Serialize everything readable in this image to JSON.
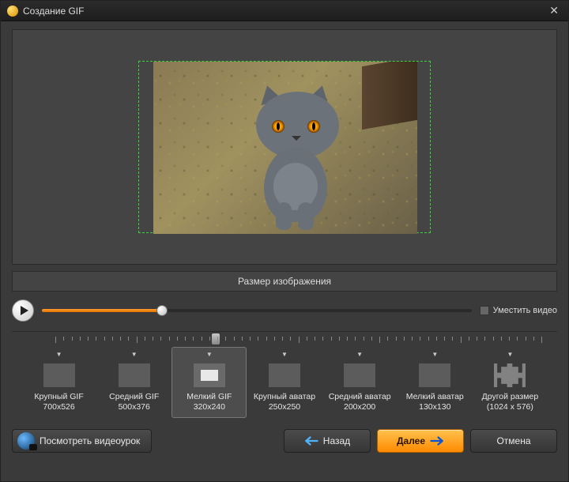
{
  "window": {
    "title": "Создание GIF"
  },
  "section": {
    "size_label": "Размер изображения"
  },
  "slider": {
    "position_percent": 28,
    "fit_label": "Уместить видео"
  },
  "presets": [
    {
      "label": "Крупный GIF",
      "dims": "700x526",
      "inner_w": 0,
      "inner_h": 0
    },
    {
      "label": "Средний GIF",
      "dims": "500x376",
      "inner_w": 0,
      "inner_h": 0
    },
    {
      "label": "Мелкий GIF",
      "dims": "320x240",
      "inner_w": 22,
      "inner_h": 14,
      "selected": true
    },
    {
      "label": "Крупный аватар",
      "dims": "250x250",
      "inner_w": 0,
      "inner_h": 0
    },
    {
      "label": "Средний аватар",
      "dims": "200x200",
      "inner_w": 0,
      "inner_h": 0
    },
    {
      "label": "Мелкий аватар",
      "dims": "130x130",
      "inner_w": 0,
      "inner_h": 0
    },
    {
      "label": "Другой размер",
      "dims": "(1024 x 576)",
      "is_custom": true
    }
  ],
  "footer": {
    "video_tutorial": "Посмотреть видеоурок",
    "back": "Назад",
    "next": "Далее",
    "cancel": "Отмена"
  }
}
